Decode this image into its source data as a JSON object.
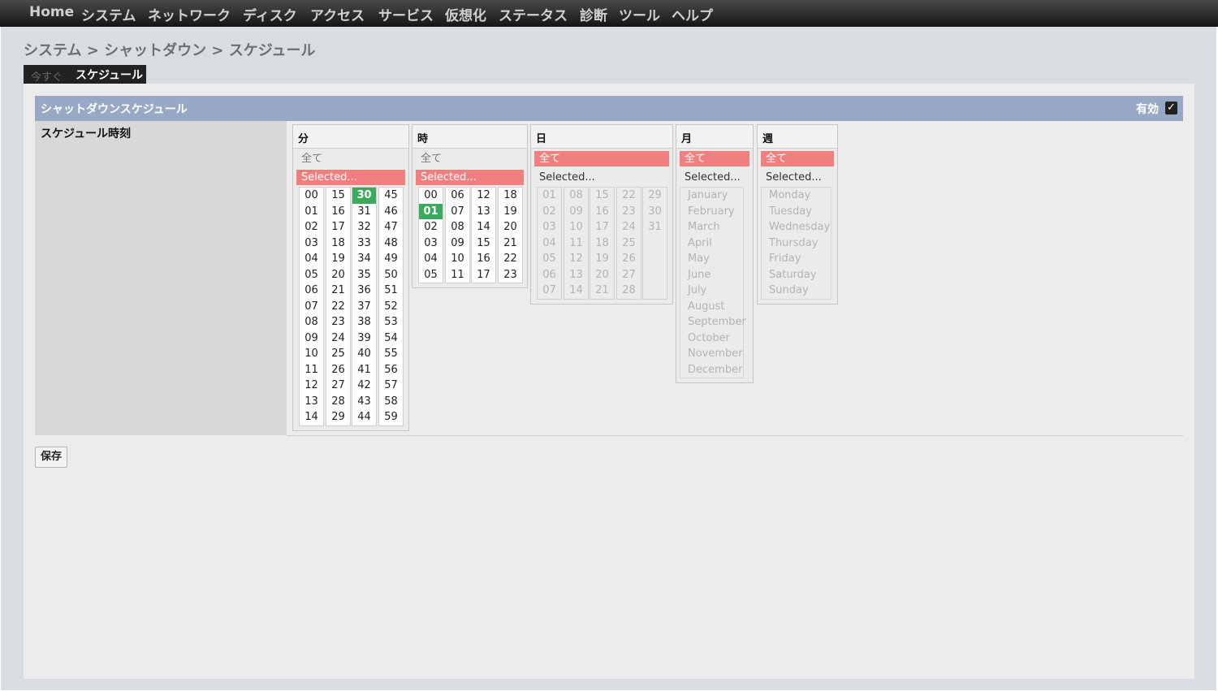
{
  "menu": [
    "Home",
    "システム",
    "ネットワーク",
    "ディスク",
    "アクセス",
    "サービス",
    "仮想化",
    "ステータス",
    "診断",
    "ツール",
    "ヘルプ"
  ],
  "breadcrumb": "システム > シャットダウン > スケジュール",
  "tabs": {
    "now": "今すぐ",
    "schedule": "スケジュール"
  },
  "section": {
    "title": "シャットダウンスケジュール",
    "enable_label": "有効",
    "enabled": true,
    "check_glyph": "✓"
  },
  "row_label": "スケジュール時刻",
  "all_label": "全て",
  "selected_label": "Selected...",
  "headers": {
    "minute": "分",
    "hour": "時",
    "day": "日",
    "month": "月",
    "week": "週"
  },
  "minute": {
    "columns": [
      [
        "00",
        "01",
        "02",
        "03",
        "04",
        "05",
        "06",
        "07",
        "08",
        "09",
        "10",
        "11",
        "12",
        "13",
        "14"
      ],
      [
        "15",
        "16",
        "17",
        "18",
        "19",
        "20",
        "21",
        "22",
        "23",
        "24",
        "25",
        "26",
        "27",
        "28",
        "29"
      ],
      [
        "30",
        "31",
        "32",
        "33",
        "34",
        "35",
        "36",
        "37",
        "38",
        "39",
        "40",
        "41",
        "42",
        "43",
        "44"
      ],
      [
        "45",
        "46",
        "47",
        "48",
        "49",
        "50",
        "51",
        "52",
        "53",
        "54",
        "55",
        "56",
        "57",
        "58",
        "59"
      ]
    ],
    "selected": [
      "30"
    ],
    "mode": "selected"
  },
  "hour": {
    "columns": [
      [
        "00",
        "01",
        "02",
        "03",
        "04",
        "05"
      ],
      [
        "06",
        "07",
        "08",
        "09",
        "10",
        "11"
      ],
      [
        "12",
        "13",
        "14",
        "15",
        "16",
        "17"
      ],
      [
        "18",
        "19",
        "20",
        "21",
        "22",
        "23"
      ]
    ],
    "selected": [
      "01"
    ],
    "mode": "selected"
  },
  "day": {
    "columns": [
      [
        "01",
        "02",
        "03",
        "04",
        "05",
        "06",
        "07"
      ],
      [
        "08",
        "09",
        "10",
        "11",
        "12",
        "13",
        "14"
      ],
      [
        "15",
        "16",
        "17",
        "18",
        "19",
        "20",
        "21"
      ],
      [
        "22",
        "23",
        "24",
        "25",
        "26",
        "27",
        "28"
      ],
      [
        "29",
        "30",
        "31"
      ]
    ],
    "mode": "all"
  },
  "month": {
    "items": [
      "January",
      "February",
      "March",
      "April",
      "May",
      "June",
      "July",
      "August",
      "September",
      "October",
      "November",
      "December"
    ],
    "mode": "all"
  },
  "week": {
    "items": [
      "Monday",
      "Tuesday",
      "Wednesday",
      "Thursday",
      "Friday",
      "Saturday",
      "Sunday"
    ],
    "mode": "all"
  },
  "save_label": "保存",
  "colors": {
    "selected_bg": "#f08080",
    "active_cell": "#3aaa5c",
    "section_header": "#97a9c5"
  }
}
